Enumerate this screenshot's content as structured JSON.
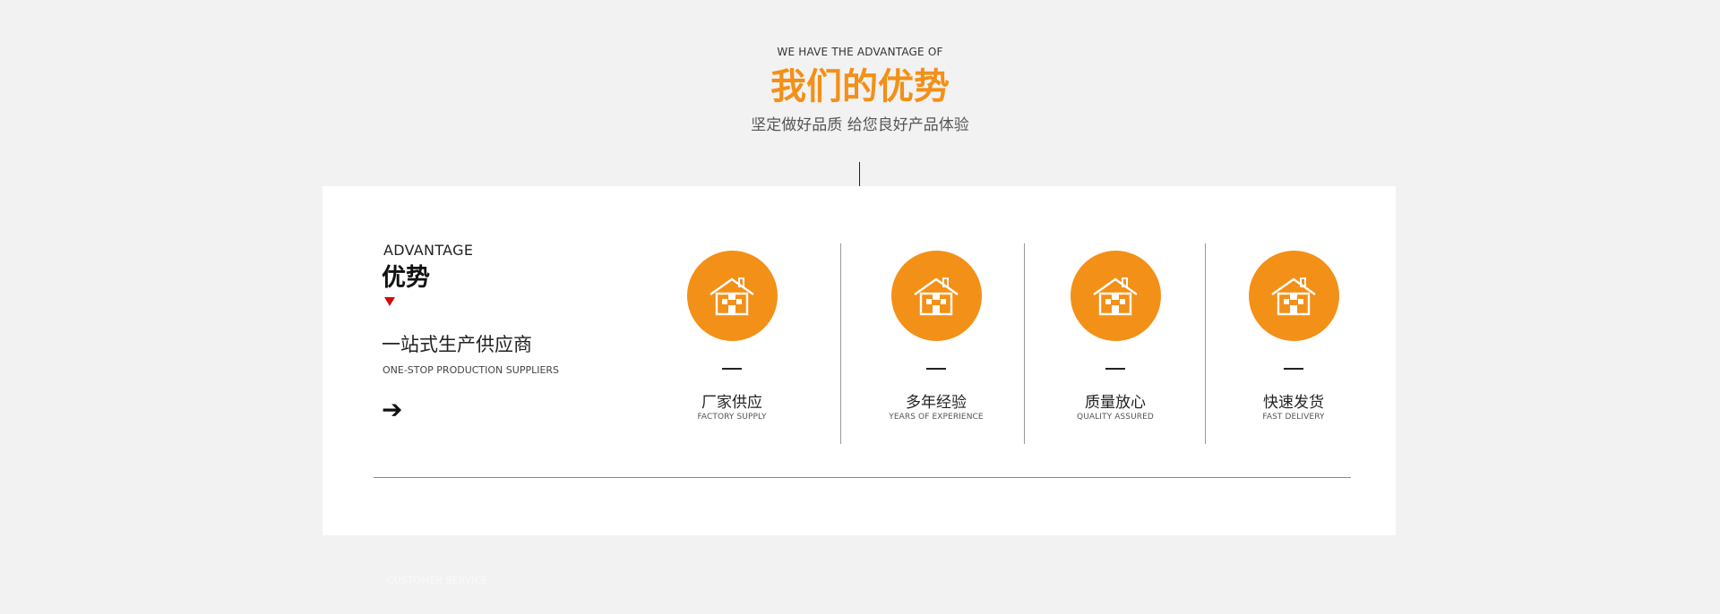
{
  "header": {
    "eyebrow": "WE HAVE THE ADVANTAGE OF",
    "title": "我们的优势",
    "subtitle": "坚定做好品质 给您良好产品体验"
  },
  "advantage": {
    "label_en": "ADVANTAGE",
    "label_cn": "优势",
    "tagline_cn": "一站式生产供应商",
    "tagline_en": "ONE-STOP PRODUCTION SUPPLIERS",
    "arrow_icon": "arrow-right-icon"
  },
  "features": [
    {
      "icon": "house-icon",
      "label_cn": "厂家供应",
      "label_en": "FACTORY SUPPLY"
    },
    {
      "icon": "house-icon",
      "label_cn": "多年经验",
      "label_en": "YEARS OF EXPERIENCE"
    },
    {
      "icon": "house-icon",
      "label_cn": "质量放心",
      "label_en": "QUALITY ASSURED"
    },
    {
      "icon": "house-icon",
      "label_cn": "快速发货",
      "label_en": "FAST DELIVERY"
    }
  ],
  "footer": {
    "faint_text": "CUSTOMER SERVICE"
  },
  "colors": {
    "accent": "#f39017",
    "marker": "#d20d0d",
    "background": "#f2f2f2",
    "card": "#ffffff"
  }
}
